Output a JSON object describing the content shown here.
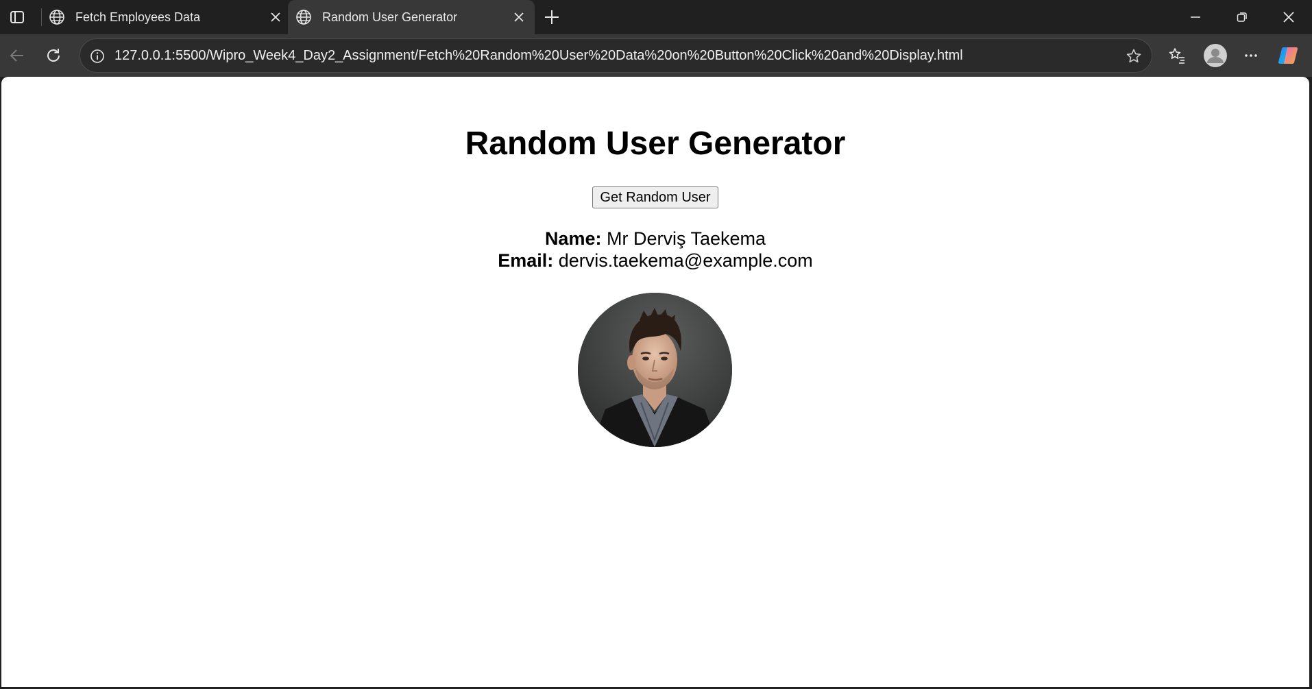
{
  "browser": {
    "tabs": [
      {
        "title": "Fetch Employees Data",
        "active": false
      },
      {
        "title": "Random User Generator",
        "active": true
      }
    ],
    "address": "127.0.0.1:5500/Wipro_Week4_Day2_Assignment/Fetch%20Random%20User%20Data%20on%20Button%20Click%20and%20Display.html",
    "icons": [
      "tab-actions-icon",
      "globe-icon",
      "close-icon",
      "plus-icon",
      "minimize-icon",
      "restore-icon",
      "window-close-icon",
      "back-icon",
      "reload-icon",
      "info-icon",
      "star-icon",
      "favorites-icon",
      "profile-icon",
      "more-icon",
      "copilot-icon"
    ]
  },
  "page": {
    "heading": "Random User Generator",
    "button_label": "Get Random User",
    "name_label": "Name:",
    "name_value": "Mr Derviş Taekema",
    "email_label": "Email:",
    "email_value": "dervis.taekema@example.com"
  },
  "colors": {
    "chrome_dark": "#202020",
    "toolbar": "#383838",
    "page_bg": "#ffffff"
  }
}
